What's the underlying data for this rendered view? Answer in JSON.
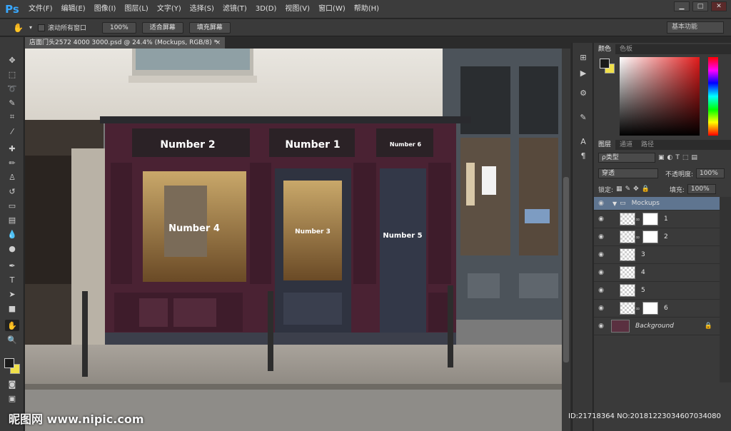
{
  "app": {
    "logo": "Ps"
  },
  "menu": [
    "文件(F)",
    "编辑(E)",
    "图像(I)",
    "图层(L)",
    "文字(Y)",
    "选择(S)",
    "滤镜(T)",
    "3D(D)",
    "视图(V)",
    "窗口(W)",
    "帮助(H)"
  ],
  "window_controls": {
    "minimize": "▁",
    "restore": "□",
    "close": "✕"
  },
  "options": {
    "scroll_all_label": "滚动所有窗口",
    "zoom_100": "100%",
    "fit_screen": "适合屏幕",
    "fill_screen": "填充屏幕",
    "workspace": "基本功能"
  },
  "document": {
    "tab_title": "店面门头2572 4000 3000.psd @ 24.4% (Mockups, RGB/8) *",
    "close": "×",
    "sign_labels": [
      "Number 2",
      "Number 1",
      "Number 6",
      "Number 4",
      "Number 3",
      "Number 5"
    ]
  },
  "color_panel": {
    "tabs": [
      "颜色",
      "色板"
    ]
  },
  "layers_panel": {
    "tabs": [
      "图层",
      "通道",
      "路径"
    ],
    "kind_filter": "ρ类型",
    "blend_mode": "穿透",
    "opacity_label": "不透明度:",
    "opacity_value": "100%",
    "lock_label": "锁定:",
    "fill_label": "填充:",
    "fill_value": "100%",
    "group_name": "Mockups",
    "layers": [
      {
        "name": "1",
        "mask": true
      },
      {
        "name": "2",
        "mask": true
      },
      {
        "name": "3",
        "mask": false
      },
      {
        "name": "4",
        "mask": false
      },
      {
        "name": "5",
        "mask": false
      },
      {
        "name": "6",
        "mask": true
      }
    ],
    "background_name": "Background"
  },
  "overlay": {
    "watermark": "昵图网 www.nipic.com",
    "id_text": "ID:21718364 NO:20181223034607034080"
  },
  "colors": {
    "accent": "#39a8ff",
    "shopfront": "#4a2233",
    "panel": "#3a3a3a",
    "selected_layer": "#5f7590"
  }
}
